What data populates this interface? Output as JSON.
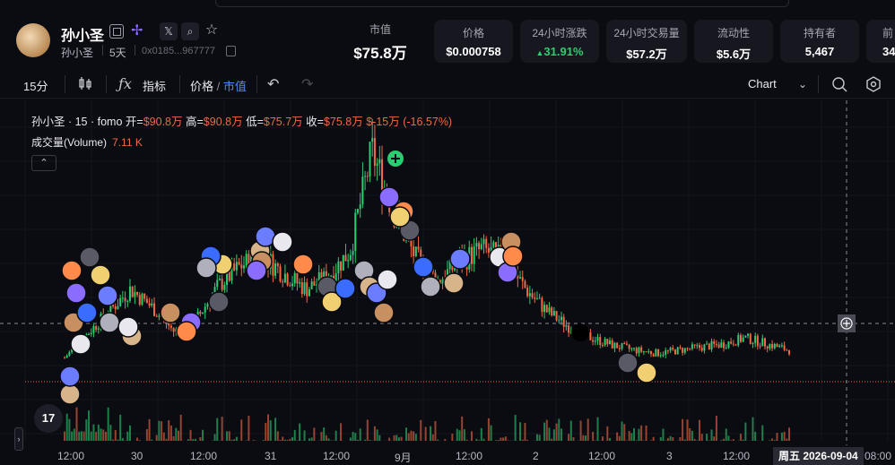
{
  "token": {
    "name": "孙小圣",
    "symbol": "孙小圣",
    "age": "5天",
    "address": "0x0185...967777"
  },
  "market_cap": {
    "label": "市值",
    "value": "$75.8万"
  },
  "stats": [
    {
      "label": "价格",
      "value": "$0.000758",
      "color": "#ffffff"
    },
    {
      "label": "24小时涨跌",
      "value": "31.91%",
      "color": "#2ecc71",
      "arrow": "up"
    },
    {
      "label": "24小时交易量",
      "value": "$57.2万",
      "color": "#ffffff"
    },
    {
      "label": "流动性",
      "value": "$5.6万",
      "color": "#ffffff"
    },
    {
      "label": "持有者",
      "value": "5,467",
      "color": "#ffffff"
    },
    {
      "label": "前",
      "value": "34",
      "color": "#ffffff"
    }
  ],
  "toolbar": {
    "interval": "15分",
    "indicators_label": "指标",
    "price_label": "价格",
    "slash": "/",
    "mcap_label": "市值",
    "chart_type_label": "Chart"
  },
  "legend": {
    "title": "孙小圣 · 15 · fomo",
    "open_label": "开=",
    "open_value": "$90.8万",
    "high_label": "高=",
    "high_value": "$90.8万",
    "low_label": "低=",
    "low_value": "$75.7万",
    "close_label": "收=",
    "close_value": "$75.8万",
    "change": "$-15万 (-16.57%)",
    "volume_label": "成交量(Volume)",
    "volume_value": "7.11 K"
  },
  "tv_logo": "17",
  "date_badge": "周五 2026-09-04",
  "colors": {
    "up": "#2ecc71",
    "down": "#f06a45",
    "accent": "#4b8bff",
    "bg": "#0b0b12"
  },
  "chart_data": {
    "type": "candlestick",
    "title": "孙小圣 · 15 · fomo",
    "x_tick_labels": [
      "12:00",
      "30",
      "12:00",
      "31",
      "12:00",
      "9月",
      "12:00",
      "2",
      "12:00",
      "3",
      "12:00",
      "08:00"
    ],
    "ohlc_last": {
      "open": "$90.8万",
      "high": "$90.8万",
      "low": "$75.7万",
      "close": "$75.8万"
    },
    "approx_market_cap_path_wan": [
      25,
      40,
      55,
      70,
      58,
      42,
      50,
      72,
      85,
      92,
      80,
      70,
      78,
      95,
      160,
      120,
      90,
      75,
      88,
      96,
      90,
      70,
      55,
      45,
      38,
      33,
      30,
      28,
      30,
      32,
      34,
      38,
      34,
      30
    ],
    "legend": "top-left",
    "grid": true
  }
}
